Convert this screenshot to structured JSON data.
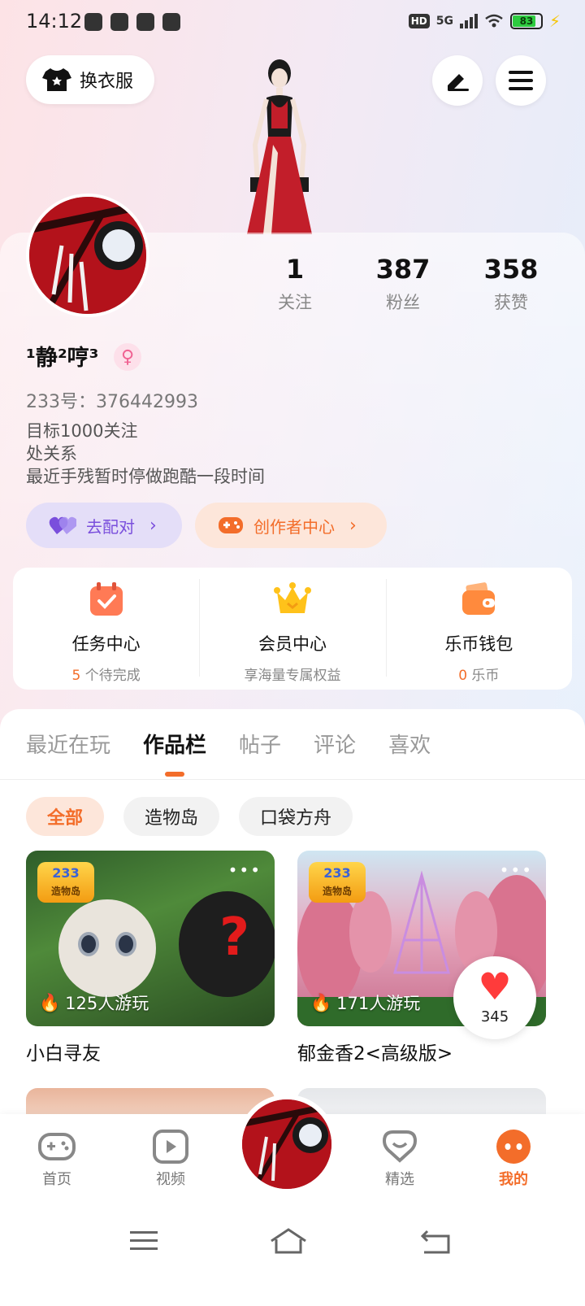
{
  "status_bar": {
    "time": "14:12",
    "network": "5G",
    "hd": "HD",
    "battery": "83"
  },
  "header": {
    "outfit_label": "换衣服",
    "outfit_icon": "shirt-icon",
    "edit_icon": "edit-pen-icon",
    "menu_icon": "hamburger-menu-icon"
  },
  "profile": {
    "stats": [
      {
        "value": "1",
        "label": "关注"
      },
      {
        "value": "387",
        "label": "粉丝"
      },
      {
        "value": "358",
        "label": "获赞"
      }
    ],
    "nickname": "¹静²哼³",
    "gender_symbol": "♀",
    "id_line": "233号：376442993",
    "bio": [
      "目标1000关注",
      "处关系",
      "最近手残暂时停做跑酷一段时间"
    ],
    "match_label": "去配对",
    "creator_label": "创作者中心",
    "chevron": "›"
  },
  "services": [
    {
      "title": "任务中心",
      "sub_highlight": "5",
      "sub_text": " 个待完成",
      "icon": "task-calendar-icon"
    },
    {
      "title": "会员中心",
      "sub_highlight": "",
      "sub_text": "享海量专属权益",
      "icon": "crown-icon"
    },
    {
      "title": "乐币钱包",
      "sub_highlight": "0",
      "sub_text": " 乐币",
      "icon": "wallet-icon"
    }
  ],
  "tabs": [
    "最近在玩",
    "作品栏",
    "帖子",
    "评论",
    "喜欢"
  ],
  "chips": [
    "全部",
    "造物岛",
    "口袋方舟"
  ],
  "games": [
    {
      "title": "小白寻友",
      "plays": "125人游玩",
      "badge_num": "233",
      "badge_text": "造物岛"
    },
    {
      "title": "郁金香2<高级版>",
      "plays": "171人游玩",
      "badge_num": "233",
      "badge_text": "造物岛"
    }
  ],
  "like_float": {
    "count": "345",
    "icon": "heart-icon"
  },
  "bottom_nav": [
    {
      "label": "首页",
      "icon": "gamepad-icon"
    },
    {
      "label": "视频",
      "icon": "video-play-icon"
    },
    {
      "label": "精选",
      "icon": "heart-chat-icon"
    },
    {
      "label": "我的",
      "icon": "smile-face-icon"
    }
  ],
  "colors": {
    "accent": "#f36d2a",
    "match_purple": "#7a4fdc",
    "avatar_red": "#b3121b"
  }
}
